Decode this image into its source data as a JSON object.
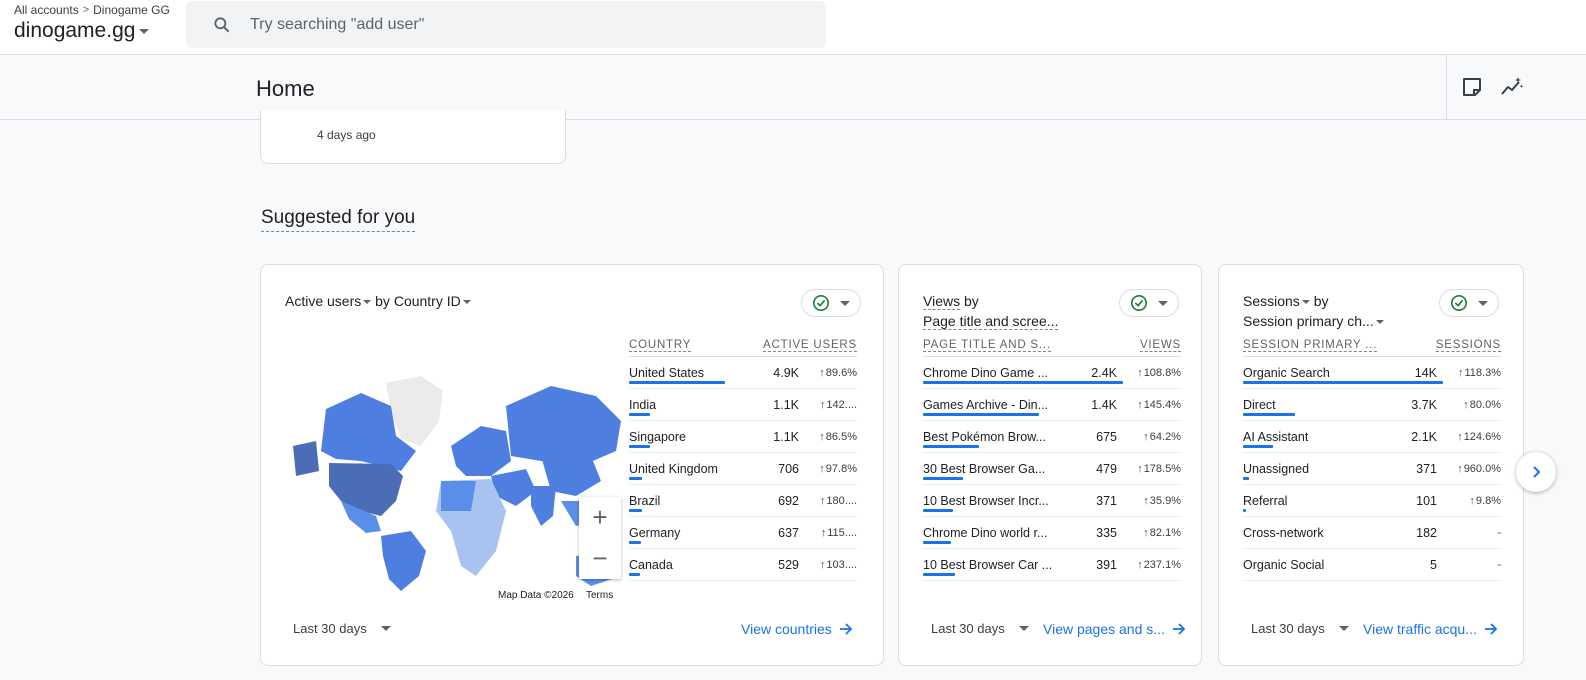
{
  "breadcrumb": {
    "all_accounts": "All accounts",
    "separator": ">",
    "account": "Dinogame GG"
  },
  "property": {
    "name": "dinogame.gg"
  },
  "search": {
    "placeholder": "Try searching \"add user\""
  },
  "header": {
    "title": "Home"
  },
  "old_card": {
    "time": "4 days ago"
  },
  "section": {
    "title": "Suggested for you"
  },
  "cards": [
    {
      "metric": "Active users",
      "by": "by",
      "dimension": "Country ID",
      "col1": "COUNTRY",
      "col2": "ACTIVE USERS",
      "rows": [
        {
          "name": "United States",
          "value": "4.9K",
          "change": "89.6%",
          "bar": 1.0
        },
        {
          "name": "India",
          "value": "1.1K",
          "change": "142....",
          "bar": 0.22
        },
        {
          "name": "Singapore",
          "value": "1.1K",
          "change": "86.5%",
          "bar": 0.22
        },
        {
          "name": "United Kingdom",
          "value": "706",
          "change": "97.8%",
          "bar": 0.14
        },
        {
          "name": "Brazil",
          "value": "692",
          "change": "180....",
          "bar": 0.14
        },
        {
          "name": "Germany",
          "value": "637",
          "change": "115....",
          "bar": 0.13
        },
        {
          "name": "Canada",
          "value": "529",
          "change": "103....",
          "bar": 0.11
        }
      ],
      "map_data": "Map Data ©2026",
      "map_terms": "Terms",
      "range": "Last 30 days",
      "link": "View countries"
    },
    {
      "metric": "Views",
      "by": "by",
      "dimension": "Page title and scree...",
      "col1": "PAGE TITLE AND S...",
      "col2": "VIEWS",
      "rows": [
        {
          "name": "Chrome Dino Game ...",
          "value": "2.4K",
          "change": "108.8%",
          "bar": 1.0
        },
        {
          "name": "Games Archive - Din...",
          "value": "1.4K",
          "change": "145.4%",
          "bar": 0.58
        },
        {
          "name": "Best Pokémon Brow...",
          "value": "675",
          "change": "64.2%",
          "bar": 0.28
        },
        {
          "name": "30 Best Browser Ga...",
          "value": "479",
          "change": "178.5%",
          "bar": 0.2
        },
        {
          "name": "10 Best Browser Incr...",
          "value": "371",
          "change": "35.9%",
          "bar": 0.15
        },
        {
          "name": "Chrome Dino world r...",
          "value": "335",
          "change": "82.1%",
          "bar": 0.14
        },
        {
          "name": "10 Best Browser Car ...",
          "value": "391",
          "change": "237.1%",
          "bar": 0.16
        }
      ],
      "range": "Last 30 days",
      "link": "View pages and s..."
    },
    {
      "metric": "Sessions",
      "by": "by",
      "dimension": "Session primary ch...",
      "col1": "SESSION PRIMARY ...",
      "col2": "SESSIONS",
      "rows": [
        {
          "name": "Organic Search",
          "value": "14K",
          "change": "118.3%",
          "arrow": true,
          "bar": 1.0
        },
        {
          "name": "Direct",
          "value": "3.7K",
          "change": "80.0%",
          "arrow": true,
          "bar": 0.26
        },
        {
          "name": "AI Assistant",
          "value": "2.1K",
          "change": "124.6%",
          "arrow": true,
          "bar": 0.15
        },
        {
          "name": "Unassigned",
          "value": "371",
          "change": "960.0%",
          "arrow": true,
          "bar": 0.03
        },
        {
          "name": "Referral",
          "value": "101",
          "change": "9.8%",
          "arrow": true,
          "bar": 0.01
        },
        {
          "name": "Cross-network",
          "value": "182",
          "change": "-",
          "arrow": false,
          "bar": 0.0
        },
        {
          "name": "Organic Social",
          "value": "5",
          "change": "-",
          "arrow": false,
          "bar": 0.0
        }
      ],
      "range": "Last 30 days",
      "link": "View traffic acqu..."
    }
  ],
  "colors": {
    "accent": "#1a73e8",
    "up": "#137333",
    "check": "#188038",
    "map_dark": "#4a6db5",
    "map_mid": "#5b8ee8",
    "map_light": "#a9c3f0"
  }
}
